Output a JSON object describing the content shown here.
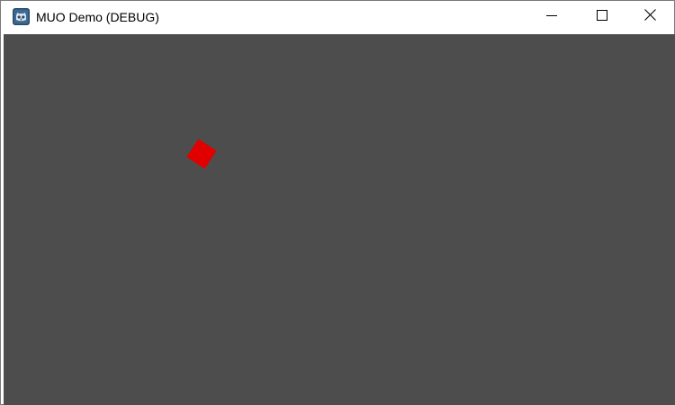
{
  "window": {
    "title": "MUO Demo (DEBUG)",
    "app_icon": "godot-engine-icon"
  },
  "caption_buttons": {
    "minimize_icon": "minimize-icon",
    "maximize_icon": "maximize-icon",
    "close_icon": "close-icon"
  },
  "game": {
    "background_color": "#4d4d4d",
    "square_color": "#e00000"
  }
}
